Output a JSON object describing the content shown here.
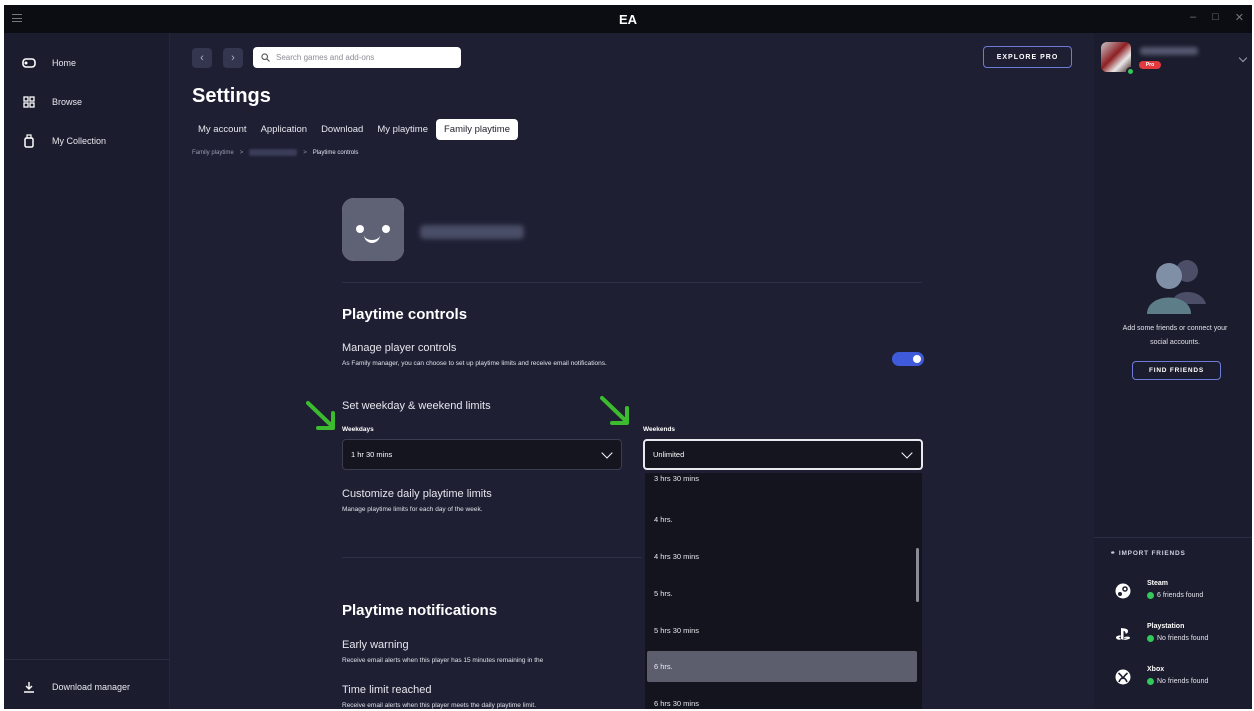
{
  "window": {
    "title": "EA",
    "controls": [
      "–",
      "□",
      "✕"
    ]
  },
  "nav": {
    "items": [
      {
        "label": "Home",
        "icon": "home-icon"
      },
      {
        "label": "Browse",
        "icon": "browse-icon"
      },
      {
        "label": "My Collection",
        "icon": "collection-icon"
      }
    ],
    "download_manager": "Download manager"
  },
  "header": {
    "back": "‹",
    "forward": "›",
    "search_placeholder": "Search games and add-ons",
    "explore_label": "EXPLORE PRO"
  },
  "settings": {
    "title": "Settings",
    "tabs": [
      "My account",
      "Application",
      "Download",
      "My playtime",
      "Family playtime"
    ],
    "active_tab": "Family playtime",
    "breadcrumb": {
      "root": "Family playtime",
      "sep": ">",
      "current": "Playtime controls"
    }
  },
  "controls": {
    "section_title": "Playtime controls",
    "manage_label": "Manage player controls",
    "manage_desc": "As Family manager, you can choose to set up playtime limits and receive email notifications.",
    "toggle_on": true,
    "limits_label": "Set weekday & weekend limits",
    "weekdays_label": "Weekdays",
    "weekdays_value": "1 hr 30 mins",
    "weekends_label": "Weekends",
    "weekends_value": "Unlimited",
    "customize_label": "Customize daily playtime limits",
    "customize_desc": "Manage playtime limits for each day of the week."
  },
  "dropdown": {
    "options": [
      "3 hrs 30 mins",
      "4 hrs.",
      "4 hrs 30 mins",
      "5 hrs.",
      "5 hrs 30 mins",
      "6 hrs.",
      "6 hrs 30 mins"
    ],
    "highlighted": "6 hrs."
  },
  "notifications": {
    "section_title": "Playtime notifications",
    "early_label": "Early warning",
    "early_desc": "Receive email alerts when this player has 15 minutes remaining in the",
    "limit_label": "Time limit reached",
    "limit_desc": "Receive email alerts when this player meets the daily playtime limit."
  },
  "right_panel": {
    "pro_badge": "Pro",
    "empty_text_line1": "Add some friends or connect your",
    "empty_text_line2": "social accounts.",
    "find_friends": "FIND FRIENDS",
    "import_title": "IMPORT FRIENDS",
    "imports": [
      {
        "name": "Steam",
        "status": "6 friends found",
        "icon": "steam-icon"
      },
      {
        "name": "Playstation",
        "status": "No friends found",
        "icon": "playstation-icon"
      },
      {
        "name": "Xbox",
        "status": "No friends found",
        "icon": "xbox-icon"
      }
    ]
  },
  "colors": {
    "accent": "#3f5bdc",
    "background": "#1e1f33",
    "highlight_arrow": "#3dbb2e",
    "online": "#34c759"
  }
}
